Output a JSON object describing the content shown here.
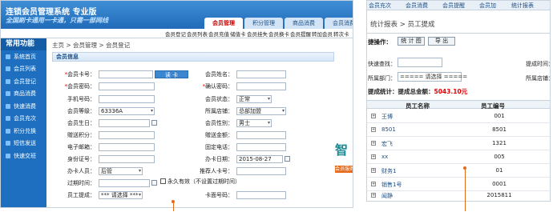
{
  "left": {
    "app_title": "连锁会员管理系统 专业版",
    "slogan": "全国刷卡通用一卡通，只需一部网线",
    "tabs": [
      "会员管理",
      "积分管理",
      "商品消费",
      "会员消费"
    ],
    "subnav": [
      "会员登记",
      "会员列表",
      "会员充值",
      "储值卡",
      "会员挂失",
      "会员换卡",
      "会员提醒",
      "转加会员",
      "转次卡"
    ],
    "sidebar_title": "常用功能",
    "sidebar_items": [
      "系统首页",
      "会员列表",
      "会员登记",
      "商品消费",
      "快速消费",
      "会员充次",
      "积分兑换",
      "短信发送",
      "快速交班"
    ],
    "breadcrumb": "主页 > 会员管理 > 会员登记",
    "form_title": "会员信息",
    "labels_left": [
      "会员卡号：",
      "会员密码：",
      "手机号码：",
      "会员等级：",
      "会员生日：",
      "赠送积分：",
      "电子邮箱：",
      "身份证号：",
      "办卡人员：",
      "过期时间：",
      "员工提成："
    ],
    "labels_right": [
      "会员姓名：",
      "确认密码：",
      "会员状态：",
      "所属店铺：",
      "会员性别：",
      "赠送金额：",
      "固定电话：",
      "办卡日期：",
      "推荐人卡号：",
      "",
      "卡面号码："
    ],
    "required_marks": [
      "*",
      "*",
      "*"
    ],
    "values": {
      "level": "63336A",
      "status": "正常",
      "store": "总部加盟",
      "gender": "男士",
      "date": "2015-08-27",
      "operator": "后管",
      "commission": "*** 请选择 ***"
    },
    "read_card_button": "读 卡",
    "never_expire": "永久有效（不设置过期时间）",
    "promo_char": "智",
    "promo_orange": "会员服务"
  },
  "right": {
    "top_tabs": [
      "会员充次",
      "会员消费",
      "会员提醒",
      "会员加",
      "统计报表"
    ],
    "breadcrumb": "统计报表 > 员工提成",
    "operation_label": "捷操作：",
    "buttons": [
      "统 计 图",
      "导 出"
    ],
    "quick_search_label": "快速查找：",
    "time_label": "提成时间：",
    "dept_label": "所属部门：",
    "dept_value": "===== 请选择 =====",
    "store_label": "所属店铺：",
    "stats_label": "提成统计：提成总金额：",
    "total_amount": "5043.10元",
    "columns": [
      "员工名称",
      "员工编号"
    ],
    "rows": [
      {
        "name": "王博",
        "id": "001"
      },
      {
        "name": "8501",
        "id": "8501"
      },
      {
        "name": "宏飞",
        "id": "1321"
      },
      {
        "name": "xx",
        "id": "005"
      },
      {
        "name": "财务1",
        "id": "01"
      },
      {
        "name": "销售1号",
        "id": "0001"
      },
      {
        "name": "闻静",
        "id": "2015811"
      }
    ]
  }
}
